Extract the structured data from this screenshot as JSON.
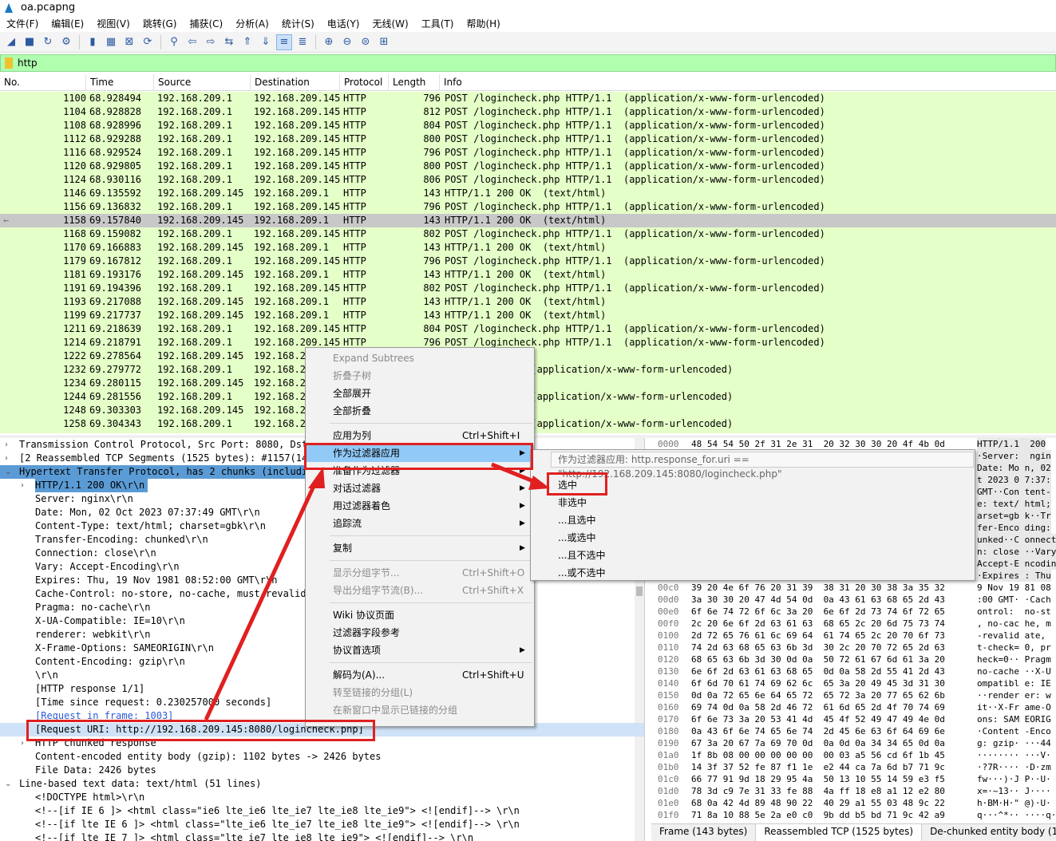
{
  "window": {
    "title": "oa.pcapng"
  },
  "menubar": [
    "文件(F)",
    "编辑(E)",
    "视图(V)",
    "跳转(G)",
    "捕获(C)",
    "分析(A)",
    "统计(S)",
    "电话(Y)",
    "无线(W)",
    "工具(T)",
    "帮助(H)"
  ],
  "toolbar_icons": [
    "start-capture-icon",
    "stop-capture-icon",
    "restart-capture-icon",
    "capture-options-icon",
    "open-file-icon",
    "save-file-icon",
    "close-file-icon",
    "reload-file-icon",
    "find-packet-icon",
    "go-back-icon",
    "go-forward-icon",
    "go-to-packet-icon",
    "go-first-icon",
    "go-last-icon",
    "autoscroll-icon",
    "colorize-icon",
    "zoom-in-icon",
    "zoom-out-icon",
    "zoom-normal-icon",
    "resize-columns-icon"
  ],
  "filter": {
    "value": "http"
  },
  "columns": [
    "No.",
    "Time",
    "Source",
    "Destination",
    "Protocol",
    "Length",
    "Info"
  ],
  "packets": [
    [
      "1100",
      "68.928494",
      "192.168.209.1",
      "192.168.209.145",
      "HTTP",
      "796",
      "POST /logincheck.php HTTP/1.1  (application/x-www-form-urlencoded)"
    ],
    [
      "1104",
      "68.928828",
      "192.168.209.1",
      "192.168.209.145",
      "HTTP",
      "812",
      "POST /logincheck.php HTTP/1.1  (application/x-www-form-urlencoded)"
    ],
    [
      "1108",
      "68.928996",
      "192.168.209.1",
      "192.168.209.145",
      "HTTP",
      "804",
      "POST /logincheck.php HTTP/1.1  (application/x-www-form-urlencoded)"
    ],
    [
      "1112",
      "68.929288",
      "192.168.209.1",
      "192.168.209.145",
      "HTTP",
      "800",
      "POST /logincheck.php HTTP/1.1  (application/x-www-form-urlencoded)"
    ],
    [
      "1116",
      "68.929524",
      "192.168.209.1",
      "192.168.209.145",
      "HTTP",
      "796",
      "POST /logincheck.php HTTP/1.1  (application/x-www-form-urlencoded)"
    ],
    [
      "1120",
      "68.929805",
      "192.168.209.1",
      "192.168.209.145",
      "HTTP",
      "800",
      "POST /logincheck.php HTTP/1.1  (application/x-www-form-urlencoded)"
    ],
    [
      "1124",
      "68.930116",
      "192.168.209.1",
      "192.168.209.145",
      "HTTP",
      "806",
      "POST /logincheck.php HTTP/1.1  (application/x-www-form-urlencoded)"
    ],
    [
      "1146",
      "69.135592",
      "192.168.209.145",
      "192.168.209.1",
      "HTTP",
      "143",
      "HTTP/1.1 200 OK  (text/html)"
    ],
    [
      "1156",
      "69.136832",
      "192.168.209.1",
      "192.168.209.145",
      "HTTP",
      "796",
      "POST /logincheck.php HTTP/1.1  (application/x-www-form-urlencoded)"
    ],
    [
      "1158",
      "69.157840",
      "192.168.209.145",
      "192.168.209.1",
      "HTTP",
      "143",
      "HTTP/1.1 200 OK  (text/html)"
    ],
    [
      "1168",
      "69.159082",
      "192.168.209.1",
      "192.168.209.145",
      "HTTP",
      "802",
      "POST /logincheck.php HTTP/1.1  (application/x-www-form-urlencoded)"
    ],
    [
      "1170",
      "69.166883",
      "192.168.209.145",
      "192.168.209.1",
      "HTTP",
      "143",
      "HTTP/1.1 200 OK  (text/html)"
    ],
    [
      "1179",
      "69.167812",
      "192.168.209.1",
      "192.168.209.145",
      "HTTP",
      "796",
      "POST /logincheck.php HTTP/1.1  (application/x-www-form-urlencoded)"
    ],
    [
      "1181",
      "69.193176",
      "192.168.209.145",
      "192.168.209.1",
      "HTTP",
      "143",
      "HTTP/1.1 200 OK  (text/html)"
    ],
    [
      "1191",
      "69.194396",
      "192.168.209.1",
      "192.168.209.145",
      "HTTP",
      "802",
      "POST /logincheck.php HTTP/1.1  (application/x-www-form-urlencoded)"
    ],
    [
      "1193",
      "69.217088",
      "192.168.209.145",
      "192.168.209.1",
      "HTTP",
      "143",
      "HTTP/1.1 200 OK  (text/html)"
    ],
    [
      "1199",
      "69.217737",
      "192.168.209.145",
      "192.168.209.1",
      "HTTP",
      "143",
      "HTTP/1.1 200 OK  (text/html)"
    ],
    [
      "1211",
      "69.218639",
      "192.168.209.1",
      "192.168.209.145",
      "HTTP",
      "804",
      "POST /logincheck.php HTTP/1.1  (application/x-www-form-urlencoded)"
    ],
    [
      "1214",
      "69.218791",
      "192.168.209.1",
      "192.168.209.145",
      "HTTP",
      "796",
      "POST /logincheck.php HTTP/1.1  (application/x-www-form-urlencoded)"
    ],
    [
      "1222",
      "69.278564",
      "192.168.209.145",
      "192.168.2",
      "",
      "",
      "(text/html)"
    ],
    [
      "1232",
      "69.279772",
      "192.168.209.1",
      "192.168.2",
      "",
      "",
      ".php HTTP/1.1  (application/x-www-form-urlencoded)"
    ],
    [
      "1234",
      "69.280115",
      "192.168.209.145",
      "192.168.2",
      "",
      "",
      "(text/html)"
    ],
    [
      "1244",
      "69.281556",
      "192.168.209.1",
      "192.168.2",
      "",
      "",
      ".php HTTP/1.1  (application/x-www-form-urlencoded)"
    ],
    [
      "1248",
      "69.303303",
      "192.168.209.145",
      "192.168.2",
      "",
      "",
      "(text/html)"
    ],
    [
      "1258",
      "69.304343",
      "192.168.209.1",
      "192.168.2",
      "",
      "",
      ".php HTTP/1.1  (application/x-www-form-urlencoded)"
    ]
  ],
  "selected_packet_no": "1158",
  "detail": [
    {
      "t": "Transmission Control Protocol, Src Port: 8080, Dst",
      "a": ">",
      "i": 0
    },
    {
      "t": "[2 Reassembled TCP Segments (1525 bytes): #1157(144",
      "a": ">",
      "i": 0
    },
    {
      "t": "Hypertext Transfer Protocol, has 2 chunks (includin",
      "a": "v",
      "i": 0,
      "hl": true
    },
    {
      "t": "HTTP/1.1 200 OK\\r\\n",
      "a": ">",
      "i": 1,
      "hl": true
    },
    {
      "t": "Server: nginx\\r\\n",
      "i": 1
    },
    {
      "t": "Date: Mon, 02 Oct 2023 07:37:49 GMT\\r\\n",
      "i": 1
    },
    {
      "t": "Content-Type: text/html; charset=gbk\\r\\n",
      "i": 1
    },
    {
      "t": "Transfer-Encoding: chunked\\r\\n",
      "i": 1
    },
    {
      "t": "Connection: close\\r\\n",
      "i": 1
    },
    {
      "t": "Vary: Accept-Encoding\\r\\n",
      "i": 1
    },
    {
      "t": "Expires: Thu, 19 Nov 1981 08:52:00 GMT\\r\\n",
      "i": 1
    },
    {
      "t": "Cache-Control: no-store, no-cache, must-revalida",
      "i": 1
    },
    {
      "t": "Pragma: no-cache\\r\\n",
      "i": 1
    },
    {
      "t": "X-UA-Compatible: IE=10\\r\\n",
      "i": 1
    },
    {
      "t": "renderer: webkit\\r\\n",
      "i": 1
    },
    {
      "t": "X-Frame-Options: SAMEORIGIN\\r\\n",
      "i": 1
    },
    {
      "t": "Content-Encoding: gzip\\r\\n",
      "i": 1
    },
    {
      "t": "\\r\\n",
      "i": 1
    },
    {
      "t": "[HTTP response 1/1]",
      "i": 1
    },
    {
      "t": "[Time since request: 0.230257000 seconds]",
      "i": 1
    },
    {
      "t": "[Request in frame: 1003]",
      "i": 1,
      "link": true
    },
    {
      "t": "[Request URI: http://192.168.209.145:8080/logincheck.php]",
      "i": 1,
      "hl2": true
    },
    {
      "t": "HTTP chunked response",
      "a": ">",
      "i": 1
    },
    {
      "t": "Content-encoded entity body (gzip): 1102 bytes -> 2426 bytes",
      "i": 1
    },
    {
      "t": "File Data: 2426 bytes",
      "i": 1
    },
    {
      "t": "Line-based text data: text/html (51 lines)",
      "a": "v",
      "i": 0
    },
    {
      "t": "<!DOCTYPE html>\\r\\n",
      "i": 1
    },
    {
      "t": "<!--[if IE 6 ]> <html class=\"ie6 lte_ie6 lte_ie7 lte_ie8 lte_ie9\"> <![endif]--> \\r\\n",
      "i": 1
    },
    {
      "t": "<!--[if lte IE 6 ]> <html class=\"lte_ie6 lte_ie7 lte_ie8 lte_ie9\"> <![endif]--> \\r\\n",
      "i": 1
    },
    {
      "t": "<!--[if lte IE 7 ]> <html class=\"lte_ie7 lte_ie8 lte_ie9\"> <![endif]--> \\r\\n",
      "i": 1
    }
  ],
  "hex": [
    [
      "0000",
      "48 54 54 50 2f 31 2e 31  20 32 30 30 20 4f 4b 0d",
      "HTTP/1.1  200"
    ],
    [
      "",
      "",
      "·Server:  ngin"
    ],
    [
      "",
      "",
      "Date: Mo n, 02"
    ],
    [
      "",
      "",
      "t 2023 0 7:37:"
    ],
    [
      "",
      "",
      "GMT··Con tent-"
    ],
    [
      "",
      "",
      "e: text/ html;"
    ],
    [
      "",
      "",
      "arset=gb k··Tr"
    ],
    [
      "",
      "",
      "fer-Enco ding:"
    ],
    [
      "",
      "",
      "unked··C onnect"
    ],
    [
      "",
      "",
      "n: close ··Vary"
    ],
    [
      "",
      "",
      "Accept-E ncodin"
    ],
    [
      "",
      "",
      "·Expires : Thu"
    ],
    [
      "00c0",
      "39 20 4e 6f 76 20 31 39  38 31 20 30 38 3a 35 32",
      "9 Nov 19 81 08"
    ],
    [
      "00d0",
      "3a 30 30 20 47 4d 54 0d  0a 43 61 63 68 65 2d 43",
      ":00 GMT· ·Cach"
    ],
    [
      "00e0",
      "6f 6e 74 72 6f 6c 3a 20  6e 6f 2d 73 74 6f 72 65",
      "ontrol:  no-st"
    ],
    [
      "00f0",
      "2c 20 6e 6f 2d 63 61 63  68 65 2c 20 6d 75 73 74",
      ", no-cac he, m"
    ],
    [
      "0100",
      "2d 72 65 76 61 6c 69 64  61 74 65 2c 20 70 6f 73",
      "-revalid ate,"
    ],
    [
      "0110",
      "74 2d 63 68 65 63 6b 3d  30 2c 20 70 72 65 2d 63",
      "t-check= 0, pr"
    ],
    [
      "0120",
      "68 65 63 6b 3d 30 0d 0a  50 72 61 67 6d 61 3a 20",
      "heck=0·· Pragm"
    ],
    [
      "0130",
      "6e 6f 2d 63 61 63 68 65  0d 0a 58 2d 55 41 2d 43",
      "no-cache ··X-U"
    ],
    [
      "0140",
      "6f 6d 70 61 74 69 62 6c  65 3a 20 49 45 3d 31 30",
      "ompatibl e: IE"
    ],
    [
      "0150",
      "0d 0a 72 65 6e 64 65 72  65 72 3a 20 77 65 62 6b",
      "··render er: w"
    ],
    [
      "0160",
      "69 74 0d 0a 58 2d 46 72  61 6d 65 2d 4f 70 74 69",
      "it··X-Fr ame-O"
    ],
    [
      "0170",
      "6f 6e 73 3a 20 53 41 4d  45 4f 52 49 47 49 4e 0d",
      "ons: SAM EORIG"
    ],
    [
      "0180",
      "0a 43 6f 6e 74 65 6e 74  2d 45 6e 63 6f 64 69 6e",
      "·Content -Enco"
    ],
    [
      "0190",
      "67 3a 20 67 7a 69 70 0d  0a 0d 0a 34 34 65 0d 0a",
      "g: gzip· ···44"
    ],
    [
      "01a0",
      "1f 8b 08 00 00 00 00 00  00 03 a5 56 cd 6f 1b 45",
      "········ ···V·"
    ],
    [
      "01b0",
      "14 3f 37 52 fe 87 f1 1e  e2 44 ca 7a 6d b7 71 9c",
      "·?7R···· ·D·zm"
    ],
    [
      "01c0",
      "66 77 91 9d 18 29 95 4a  50 13 10 55 14 59 e3 f5",
      "fw···)·J P··U·"
    ],
    [
      "01d0",
      "78 3d c9 7e 31 33 fe 88  4a ff 18 e8 a1 12 e2 80",
      "x=·~13·· J····"
    ],
    [
      "01e0",
      "68 0a 42 4d 89 48 90 22  40 29 a1 55 03 48 9c 22",
      "h·BM·H·\" @)·U·"
    ],
    [
      "01f0",
      "71 8a 10 88 5e 2a e0 c0  9b dd b5 bd 71 9c 42 a9",
      "q···^*·· ····q·"
    ]
  ],
  "hex_tabs": [
    "Frame (143 bytes)",
    "Reassembled TCP (1525 bytes)",
    "De-chunked entity body (1102"
  ],
  "context_menu": [
    {
      "label": "Expand Subtrees",
      "dis": true
    },
    {
      "label": "折叠子树",
      "dis": true
    },
    {
      "label": "全部展开"
    },
    {
      "label": "全部折叠"
    },
    {
      "sep": true
    },
    {
      "label": "应用为列",
      "sc": "Ctrl+Shift+I"
    },
    {
      "label": "作为过滤器应用",
      "sub": true,
      "act": true
    },
    {
      "label": "准备作为过滤器",
      "sub": true
    },
    {
      "label": "对话过滤器",
      "sub": true
    },
    {
      "label": "用过滤器着色",
      "sub": true
    },
    {
      "label": "追踪流",
      "sub": true
    },
    {
      "sep": true
    },
    {
      "label": "复制",
      "sub": true
    },
    {
      "sep": true
    },
    {
      "label": "显示分组字节...",
      "sc": "Ctrl+Shift+O",
      "dis": true
    },
    {
      "label": "导出分组字节流(B)...",
      "sc": "Ctrl+Shift+X",
      "dis": true
    },
    {
      "sep": true
    },
    {
      "label": "Wiki 协议页面"
    },
    {
      "label": "过滤器字段参考"
    },
    {
      "label": "协议首选项",
      "sub": true
    },
    {
      "sep": true
    },
    {
      "label": "解码为(A)...",
      "sc": "Ctrl+Shift+U"
    },
    {
      "label": "转至链接的分组(L)",
      "dis": true
    },
    {
      "label": "在新窗口中显示已链接的分组",
      "dis": true
    }
  ],
  "filter_tooltip": "作为过滤器应用: http.response_for.uri == \"http://192.168.209.145:8080/logincheck.php\"",
  "submenu": [
    "选中",
    "非选中",
    "...且选中",
    "...或选中",
    "...且不选中",
    "...或不选中"
  ],
  "colors": {
    "packet_bg": "#e4ffc7",
    "filter_bg": "#afffaf",
    "highlight": "#5b9bd5",
    "annotation": "#e02020",
    "menu_active": "#91c9f7"
  }
}
